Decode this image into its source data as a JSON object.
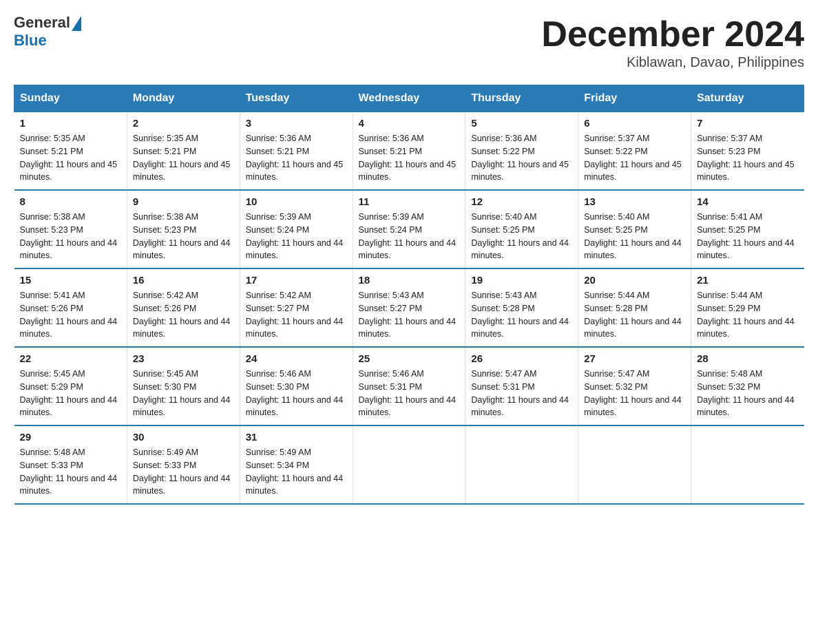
{
  "header": {
    "logo_general": "General",
    "logo_blue": "Blue",
    "month_title": "December 2024",
    "location": "Kiblawan, Davao, Philippines"
  },
  "days_of_week": [
    "Sunday",
    "Monday",
    "Tuesday",
    "Wednesday",
    "Thursday",
    "Friday",
    "Saturday"
  ],
  "weeks": [
    [
      {
        "day": "1",
        "sunrise": "5:35 AM",
        "sunset": "5:21 PM",
        "daylight": "11 hours and 45 minutes."
      },
      {
        "day": "2",
        "sunrise": "5:35 AM",
        "sunset": "5:21 PM",
        "daylight": "11 hours and 45 minutes."
      },
      {
        "day": "3",
        "sunrise": "5:36 AM",
        "sunset": "5:21 PM",
        "daylight": "11 hours and 45 minutes."
      },
      {
        "day": "4",
        "sunrise": "5:36 AM",
        "sunset": "5:21 PM",
        "daylight": "11 hours and 45 minutes."
      },
      {
        "day": "5",
        "sunrise": "5:36 AM",
        "sunset": "5:22 PM",
        "daylight": "11 hours and 45 minutes."
      },
      {
        "day": "6",
        "sunrise": "5:37 AM",
        "sunset": "5:22 PM",
        "daylight": "11 hours and 45 minutes."
      },
      {
        "day": "7",
        "sunrise": "5:37 AM",
        "sunset": "5:23 PM",
        "daylight": "11 hours and 45 minutes."
      }
    ],
    [
      {
        "day": "8",
        "sunrise": "5:38 AM",
        "sunset": "5:23 PM",
        "daylight": "11 hours and 44 minutes."
      },
      {
        "day": "9",
        "sunrise": "5:38 AM",
        "sunset": "5:23 PM",
        "daylight": "11 hours and 44 minutes."
      },
      {
        "day": "10",
        "sunrise": "5:39 AM",
        "sunset": "5:24 PM",
        "daylight": "11 hours and 44 minutes."
      },
      {
        "day": "11",
        "sunrise": "5:39 AM",
        "sunset": "5:24 PM",
        "daylight": "11 hours and 44 minutes."
      },
      {
        "day": "12",
        "sunrise": "5:40 AM",
        "sunset": "5:25 PM",
        "daylight": "11 hours and 44 minutes."
      },
      {
        "day": "13",
        "sunrise": "5:40 AM",
        "sunset": "5:25 PM",
        "daylight": "11 hours and 44 minutes."
      },
      {
        "day": "14",
        "sunrise": "5:41 AM",
        "sunset": "5:25 PM",
        "daylight": "11 hours and 44 minutes."
      }
    ],
    [
      {
        "day": "15",
        "sunrise": "5:41 AM",
        "sunset": "5:26 PM",
        "daylight": "11 hours and 44 minutes."
      },
      {
        "day": "16",
        "sunrise": "5:42 AM",
        "sunset": "5:26 PM",
        "daylight": "11 hours and 44 minutes."
      },
      {
        "day": "17",
        "sunrise": "5:42 AM",
        "sunset": "5:27 PM",
        "daylight": "11 hours and 44 minutes."
      },
      {
        "day": "18",
        "sunrise": "5:43 AM",
        "sunset": "5:27 PM",
        "daylight": "11 hours and 44 minutes."
      },
      {
        "day": "19",
        "sunrise": "5:43 AM",
        "sunset": "5:28 PM",
        "daylight": "11 hours and 44 minutes."
      },
      {
        "day": "20",
        "sunrise": "5:44 AM",
        "sunset": "5:28 PM",
        "daylight": "11 hours and 44 minutes."
      },
      {
        "day": "21",
        "sunrise": "5:44 AM",
        "sunset": "5:29 PM",
        "daylight": "11 hours and 44 minutes."
      }
    ],
    [
      {
        "day": "22",
        "sunrise": "5:45 AM",
        "sunset": "5:29 PM",
        "daylight": "11 hours and 44 minutes."
      },
      {
        "day": "23",
        "sunrise": "5:45 AM",
        "sunset": "5:30 PM",
        "daylight": "11 hours and 44 minutes."
      },
      {
        "day": "24",
        "sunrise": "5:46 AM",
        "sunset": "5:30 PM",
        "daylight": "11 hours and 44 minutes."
      },
      {
        "day": "25",
        "sunrise": "5:46 AM",
        "sunset": "5:31 PM",
        "daylight": "11 hours and 44 minutes."
      },
      {
        "day": "26",
        "sunrise": "5:47 AM",
        "sunset": "5:31 PM",
        "daylight": "11 hours and 44 minutes."
      },
      {
        "day": "27",
        "sunrise": "5:47 AM",
        "sunset": "5:32 PM",
        "daylight": "11 hours and 44 minutes."
      },
      {
        "day": "28",
        "sunrise": "5:48 AM",
        "sunset": "5:32 PM",
        "daylight": "11 hours and 44 minutes."
      }
    ],
    [
      {
        "day": "29",
        "sunrise": "5:48 AM",
        "sunset": "5:33 PM",
        "daylight": "11 hours and 44 minutes."
      },
      {
        "day": "30",
        "sunrise": "5:49 AM",
        "sunset": "5:33 PM",
        "daylight": "11 hours and 44 minutes."
      },
      {
        "day": "31",
        "sunrise": "5:49 AM",
        "sunset": "5:34 PM",
        "daylight": "11 hours and 44 minutes."
      },
      null,
      null,
      null,
      null
    ]
  ]
}
